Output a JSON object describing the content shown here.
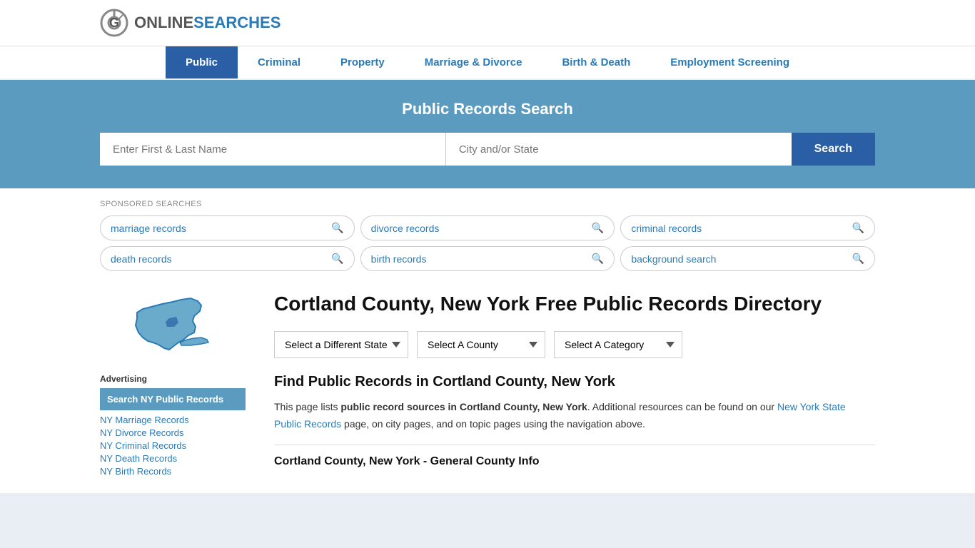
{
  "header": {
    "logo_online": "ONLINE",
    "logo_searches": "SEARCHES"
  },
  "nav": {
    "items": [
      {
        "label": "Public",
        "active": true
      },
      {
        "label": "Criminal",
        "active": false
      },
      {
        "label": "Property",
        "active": false
      },
      {
        "label": "Marriage & Divorce",
        "active": false
      },
      {
        "label": "Birth & Death",
        "active": false
      },
      {
        "label": "Employment Screening",
        "active": false
      }
    ]
  },
  "hero": {
    "title": "Public Records Search",
    "name_placeholder": "Enter First & Last Name",
    "location_placeholder": "City and/or State",
    "search_label": "Search"
  },
  "sponsored": {
    "label": "SPONSORED SEARCHES",
    "tags": [
      "marriage records",
      "divorce records",
      "criminal records",
      "death records",
      "birth records",
      "background search"
    ]
  },
  "sidebar": {
    "advertising_label": "Advertising",
    "ad_item": "Search NY Public Records",
    "links": [
      "NY Marriage Records",
      "NY Divorce Records",
      "NY Criminal Records",
      "NY Death Records",
      "NY Birth Records"
    ]
  },
  "main": {
    "page_title": "Cortland County, New York Free Public Records Directory",
    "dropdowns": {
      "state_label": "Select a Different State",
      "county_label": "Select A County",
      "category_label": "Select A Category"
    },
    "find_heading": "Find Public Records in Cortland County, New York",
    "find_text_1": "This page lists ",
    "find_text_bold": "public record sources in Cortland County, New York",
    "find_text_2": ". Additional resources can be found on our ",
    "find_link": "New York State Public Records",
    "find_text_3": " page, on city pages, and on topic pages using the navigation above.",
    "county_info_heading": "Cortland County, New York - General County Info"
  }
}
